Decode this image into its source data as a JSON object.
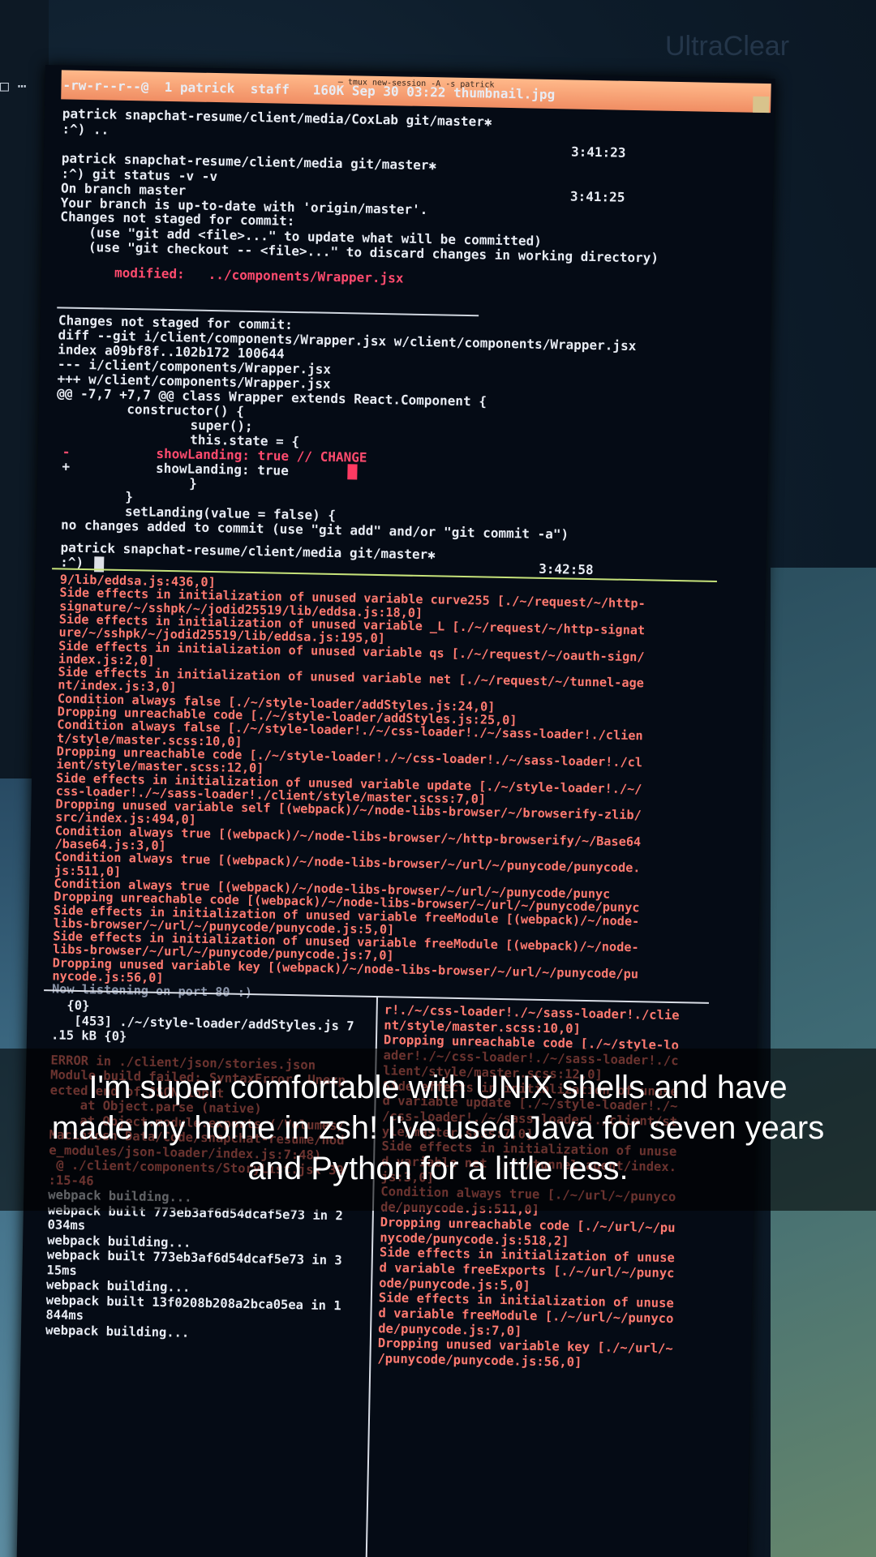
{
  "background": {
    "watermark": "UltraClear",
    "menu_icons": "□ ⋯"
  },
  "terminal": {
    "title": "— tmux new-session -A -s patrick",
    "top_pane": [
      {
        "text": "-rw-r--r--@  1 patrick  staff   160K Sep 30 03:22 thumbnail.jpg",
        "c": "w"
      },
      {
        "text": "patrick snapchat-resume/client/media/CoxLab git/master✱",
        "c": "w"
      },
      {
        "text": ":^) ..",
        "c": "w"
      },
      {
        "text": "3:41:23",
        "c": "w"
      },
      {
        "text": "patrick snapchat-resume/client/media git/master✱",
        "c": "w"
      },
      {
        "text": ":^) git status -v -v",
        "c": "w"
      },
      {
        "text": "On branch master",
        "c": "w"
      },
      {
        "text": "3:41:25",
        "c": "w"
      },
      {
        "text": "Your branch is up-to-date with 'origin/master'.",
        "c": "w"
      },
      {
        "text": "Changes not staged for commit:",
        "c": "w"
      },
      {
        "text": "  (use \"git add <file>...\" to update what will be committed)",
        "c": "w"
      },
      {
        "text": "  (use \"git checkout -- <file>...\" to discard changes in working directory)",
        "c": "w"
      },
      {
        "text": "modified:   ../components/Wrapper.jsx",
        "c": "r"
      },
      {
        "text": "Changes not staged for commit:",
        "c": "w"
      },
      {
        "text": "diff --git i/client/components/Wrapper.jsx w/client/components/Wrapper.jsx",
        "c": "w"
      },
      {
        "text": "index a09bf8f..102b172 100644",
        "c": "w"
      },
      {
        "text": "--- i/client/components/Wrapper.jsx",
        "c": "w"
      },
      {
        "text": "+++ w/client/components/Wrapper.jsx",
        "c": "w"
      },
      {
        "text": "@@ -7,7 +7,7 @@ class Wrapper extends React.Component {",
        "c": "w"
      },
      {
        "text": "    constructor() {",
        "c": "w"
      },
      {
        "text": "        super();",
        "c": "w"
      },
      {
        "text": "        this.state = {",
        "c": "w"
      },
      {
        "text": "-           showLanding: true // CHANGE",
        "c": "r"
      },
      {
        "text": "+           showLanding: true",
        "c": "w"
      },
      {
        "text": "        }",
        "c": "w"
      },
      {
        "text": "    }",
        "c": "w"
      },
      {
        "text": "    setLanding(value = false) {",
        "c": "w"
      },
      {
        "text": "no changes added to commit (use \"git add\" and/or \"git commit -a\")",
        "c": "w"
      },
      {
        "text": "patrick snapchat-resume/client/media git/master✱",
        "c": "w"
      },
      {
        "text": ":^)",
        "c": "w"
      },
      {
        "text": "3:42:58",
        "c": "w"
      }
    ],
    "middle_pane": [
      "9/lib/eddsa.js:436,0]",
      "Side effects in initialization of unused variable curve255 [./~/request/~/http-",
      "signature/~/sshpk/~/jodid25519/lib/eddsa.js:18,0]",
      "Side effects in initialization of unused variable _L [./~/request/~/http-signat",
      "ure/~/sshpk/~/jodid25519/lib/eddsa.js:195,0]",
      "Side effects in initialization of unused variable qs [./~/request/~/oauth-sign/",
      "index.js:2,0]",
      "Side effects in initialization of unused variable net [./~/request/~/tunnel-age",
      "nt/index.js:3,0]",
      "Condition always false [./~/style-loader/addStyles.js:24,0]",
      "Dropping unreachable code [./~/style-loader/addStyles.js:25,0]",
      "Condition always false [./~/style-loader!./~/css-loader!./~/sass-loader!./clien",
      "t/style/master.scss:10,0]",
      "Dropping unreachable code [./~/style-loader!./~/css-loader!./~/sass-loader!./cl",
      "ient/style/master.scss:12,0]",
      "Side effects in initialization of unused variable update [./~/style-loader!./~/",
      "css-loader!./~/sass-loader!./client/style/master.scss:7,0]",
      "Dropping unused variable self [(webpack)/~/node-libs-browser/~/browserify-zlib/",
      "src/index.js:494,0]",
      "Condition always true [(webpack)/~/node-libs-browser/~/http-browserify/~/Base64",
      "/base64.js:3,0]",
      "Condition always true [(webpack)/~/node-libs-browser/~/url/~/punycode/punycode.",
      "js:511,0]",
      "Condition always true [(webpack)/~/node-libs-browser/~/url/~/punycode/punyc",
      "Dropping unreachable code [(webpack)/~/node-libs-browser/~/url/~/punycode/punyc",
      "Side effects in initialization of unused variable freeModule [(webpack)/~/node-",
      "libs-browser/~/url/~/punycode/punycode.js:5,0]",
      "Side effects in initialization of unused variable freeModule [(webpack)/~/node-",
      "libs-browser/~/url/~/punycode/punycode.js:7,0]",
      "Dropping unused variable key [(webpack)/~/node-libs-browser/~/url/~/punycode/pu",
      "nycode.js:56,0]",
      "Now listening on port 80 :)"
    ],
    "bottom_left": [
      {
        "text": "  {0}",
        "c": "w"
      },
      {
        "text": "   [453] ./~/style-loader/addStyles.js 7",
        "c": "w"
      },
      {
        "text": ".15 kB {0}",
        "c": "w"
      },
      {
        "text": "ERROR in ./client/json/stories.json",
        "c": "o"
      },
      {
        "text": "Module build failed: SyntaxError: Unexp",
        "c": "o"
      },
      {
        "text": "ected end of JSON input",
        "c": "o"
      },
      {
        "text": "    at Object.parse (native)",
        "c": "o"
      },
      {
        "text": "    at Object.module.exports (/Volumes/",
        "c": "o"
      },
      {
        "text": "Macintosh Data/Code/snapchat-resume/nod",
        "c": "o"
      },
      {
        "text": "e_modules/json-loader/index.js:7:48)",
        "c": "o"
      },
      {
        "text": " @ ./client/components/StoryList.jsx 39",
        "c": "o"
      },
      {
        "text": ":15-46",
        "c": "o"
      },
      {
        "text": "webpack building...",
        "c": "w"
      },
      {
        "text": "webpack built 773eb3af6d54dcaf5e73 in 2",
        "c": "w"
      },
      {
        "text": "034ms",
        "c": "w"
      },
      {
        "text": "webpack building...",
        "c": "w"
      },
      {
        "text": "webpack built 773eb3af6d54dcaf5e73 in 3",
        "c": "w"
      },
      {
        "text": "15ms",
        "c": "w"
      },
      {
        "text": "webpack building...",
        "c": "w"
      },
      {
        "text": "webpack built 13f0208b208a2bca05ea in 1",
        "c": "w"
      },
      {
        "text": "844ms",
        "c": "w"
      },
      {
        "text": "webpack building...",
        "c": "w"
      }
    ],
    "bottom_right": [
      "r!./~/css-loader!./~/sass-loader!./clie",
      "nt/style/master.scss:10,0]",
      "Dropping unreachable code [./~/style-lo",
      "ader!./~/css-loader!./~/sass-loader!./c",
      "lient/style/master.scss:12,0]",
      "Side effects in initialization of unuse",
      "d variable update [./~/style-loader!./~",
      "/css-loader!./~/sass-loader!./client/st",
      "yle/master.scss:7,0]",
      "Side effects in initialization of unuse",
      "d variable net [./~/tunnel-agent/index.",
      "js:3,0]",
      "Condition always true [./~/url/~/punyco",
      "de/punycode.js:511,0]",
      "Dropping unreachable code [./~/url/~/pu",
      "nycode/punycode.js:518,2]",
      "Side effects in initialization of unuse",
      "d variable freeExports [./~/url/~/punyc",
      "ode/punycode.js:5,0]",
      "Side effects in initialization of unuse",
      "d variable freeModule [./~/url/~/punyco",
      "de/punycode.js:7,0]",
      "Dropping unused variable key [./~/url/~",
      "/punycode/punycode.js:56,0]"
    ]
  },
  "caption": {
    "lines": [
      "I'm super comfortable with UNIX shells and have",
      "made my home in zsh! I've used Java for seven years",
      "and Python for a little less."
    ]
  }
}
